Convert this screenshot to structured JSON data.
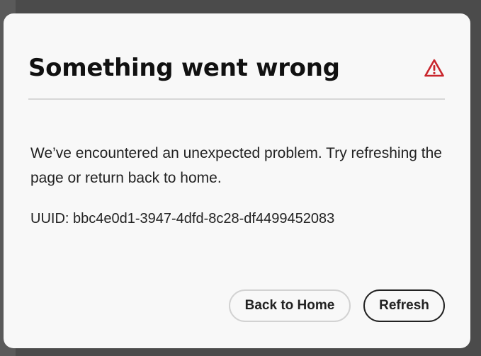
{
  "dialog": {
    "title": "Something went wrong",
    "alert_icon": "alert-triangle-icon",
    "message": "We’ve encountered an unexpected problem. Try refreshing the page or return back to home.",
    "uuid": "UUID: bbc4e0d1-3947-4dfd-8c28-df4499452083",
    "buttons": {
      "back_home": "Back to Home",
      "refresh": "Refresh"
    }
  },
  "colors": {
    "alert": "#c9252c",
    "text": "#222222",
    "dialog_bg": "#f8f8f8"
  }
}
